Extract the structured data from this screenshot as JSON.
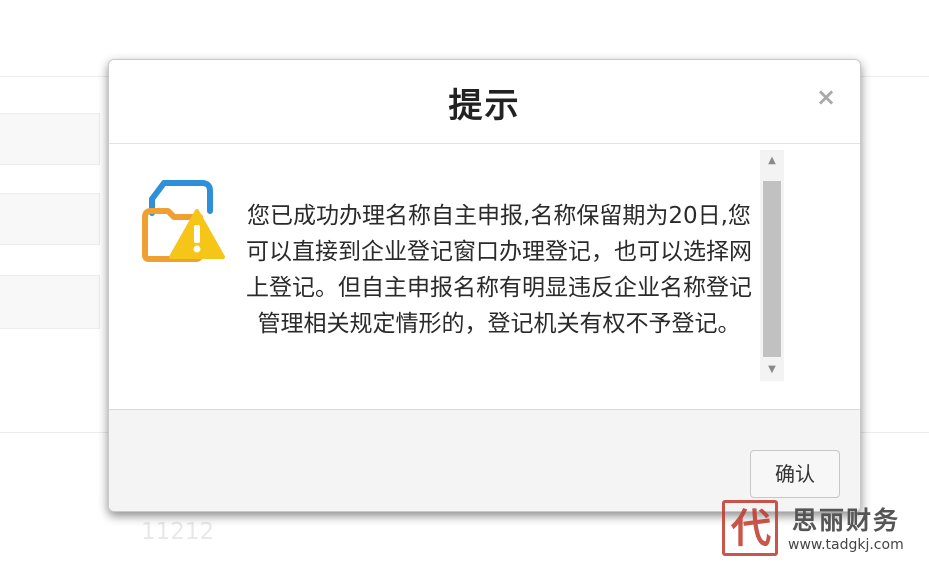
{
  "background": {
    "number": "11212"
  },
  "dialog": {
    "title": "提示",
    "close_label": "×",
    "message": "您已成功办理名称自主申报,名称保留期为20日,您可以直接到企业登记窗口办理登记，也可以选择网上登记。但自主申报名称有明显违反企业名称登记管理相关规定情形的，登记机关有权不予登记。",
    "icon": "folder-warning-icon",
    "confirm_label": "确认"
  },
  "watermark": {
    "name": "思丽财务",
    "url": "www.tadgkj.com"
  },
  "colors": {
    "icon_blue": "#2f8fd8",
    "icon_orange": "#f0a030",
    "icon_yellow": "#f5c518",
    "stamp_red": "#c0392b"
  }
}
